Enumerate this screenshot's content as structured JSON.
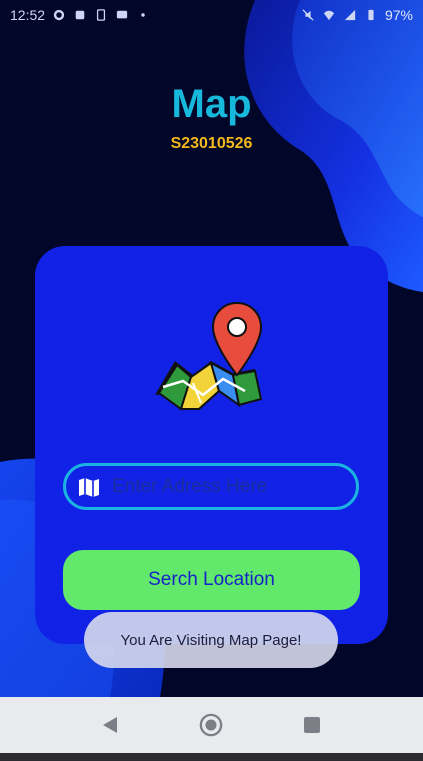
{
  "status_bar": {
    "time": "12:52",
    "battery": "97%",
    "icons": [
      "whatsapp-icon",
      "notification-icon",
      "sim-icon",
      "message-icon",
      "dot-icon",
      "mute-icon",
      "wifi-icon",
      "signal-icon",
      "battery-icon"
    ]
  },
  "header": {
    "title": "Map",
    "subtitle": "S23010526"
  },
  "card": {
    "illustration": "folded-map-with-pin-icon",
    "address_input": {
      "value": "",
      "placeholder": "Enter Adress Here",
      "icon": "map-icon"
    },
    "search_button_label": "Serch Location"
  },
  "toast": {
    "message": "You Are Visiting Map Page!"
  },
  "nav_bar": {
    "buttons": [
      "back-icon",
      "home-icon",
      "recents-icon"
    ]
  },
  "colors": {
    "background": "#020628",
    "card": "#1122e6",
    "title": "#16b8dc",
    "subtitle": "#f3b81a",
    "button": "#62e86a",
    "input_border": "#19b4e0"
  }
}
